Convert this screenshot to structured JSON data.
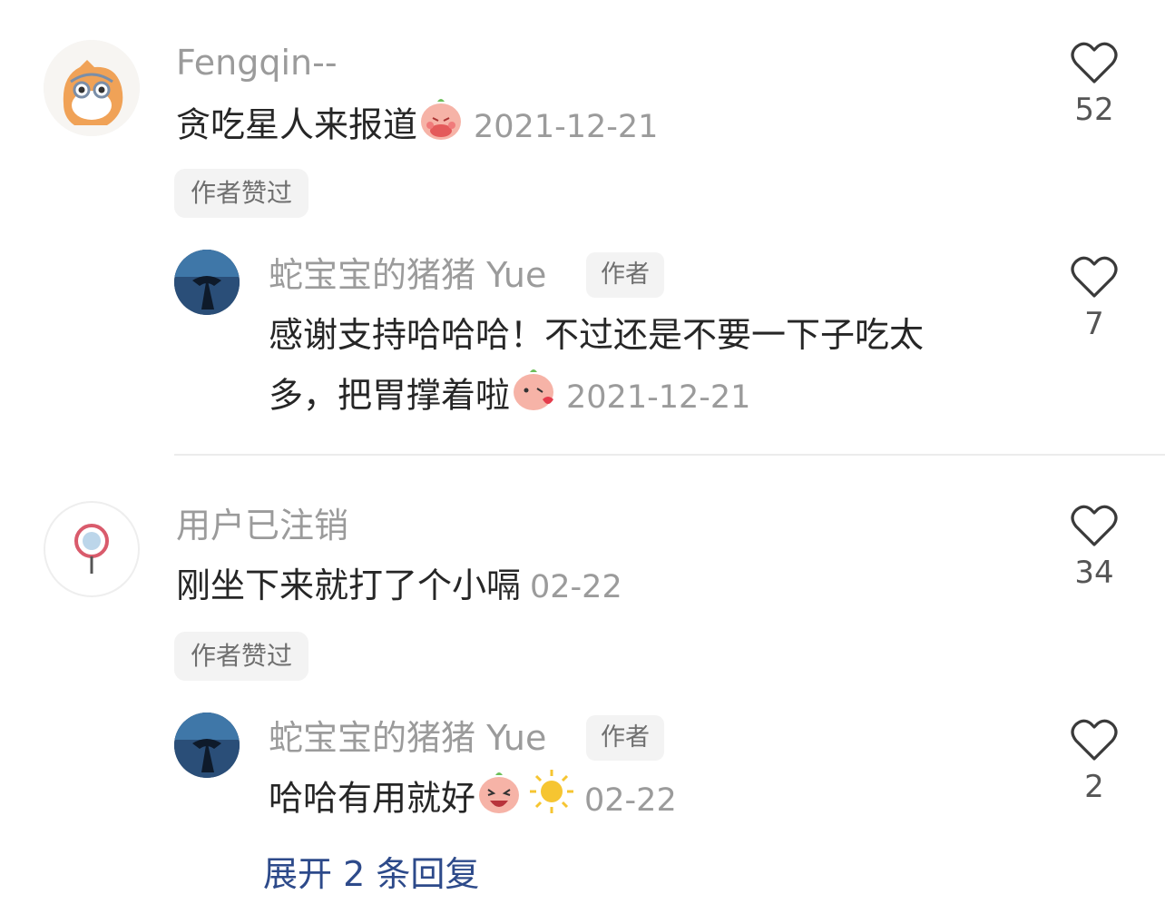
{
  "comments": [
    {
      "username": "Fengqin--",
      "text": "贪吃星人来报道",
      "date": "2021-12-21",
      "likes": "52",
      "author_liked_label": "作者赞过",
      "reply": {
        "username": "蛇宝宝的猪猪 Yue",
        "author_tag": "作者",
        "text_line1": "感谢支持哈哈哈！不过还是不要一下子吃太",
        "text_line2": "多，把胃撑着啦",
        "date": "2021-12-21",
        "likes": "7"
      }
    },
    {
      "username": "用户已注销",
      "text": "刚坐下来就打了个小嗝",
      "date": "02-22",
      "likes": "34",
      "author_liked_label": "作者赞过",
      "reply": {
        "username": "蛇宝宝的猪猪 Yue",
        "author_tag": "作者",
        "text": "哈哈有用就好",
        "date": "02-22",
        "likes": "2"
      },
      "expand_label": "展开 2 条回复"
    }
  ],
  "icons": {
    "like": "heart-outline-icon",
    "emoji1": "peach-blush-emoji",
    "emoji2": "peach-kiss-emoji",
    "emoji3": "peach-laugh-emoji",
    "emoji4": "sun-emoji"
  },
  "colors": {
    "name": "#9b9b9b",
    "text": "#262626",
    "link": "#2d4a8a",
    "chip_bg": "#f3f3f3"
  }
}
